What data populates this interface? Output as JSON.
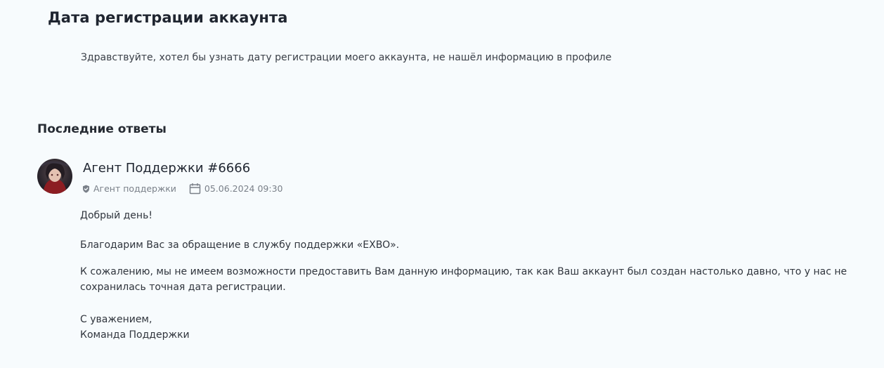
{
  "ticket": {
    "title": "Дата регистрации аккаунта",
    "body": "Здравствуйте, хотел бы узнать дату регистрации моего аккаунта, не нашёл информацию в профиле"
  },
  "replies_section": {
    "heading": "Последние ответы"
  },
  "reply": {
    "author": "Агент Поддержки #6666",
    "role": "Агент поддержки",
    "role_icon": "shield-icon",
    "date_icon": "calendar-icon",
    "datetime": "05.06.2024 09:30",
    "paragraphs": [
      "Добрый день!",
      "Благодарим Вас за обращение в службу поддержки «EXBO».",
      "К сожалению, мы не имеем возможности предоставить Вам данную информацию, так как Ваш аккаунт был создан настолько давно, что у нас не сохранилась точная дата регистрации."
    ],
    "signature": {
      "line1": "С уважением,",
      "line2": "Команда Поддержки"
    }
  },
  "colors": {
    "background": "#f7fbfd",
    "heading": "#1f2530",
    "muted": "#7a8089"
  }
}
